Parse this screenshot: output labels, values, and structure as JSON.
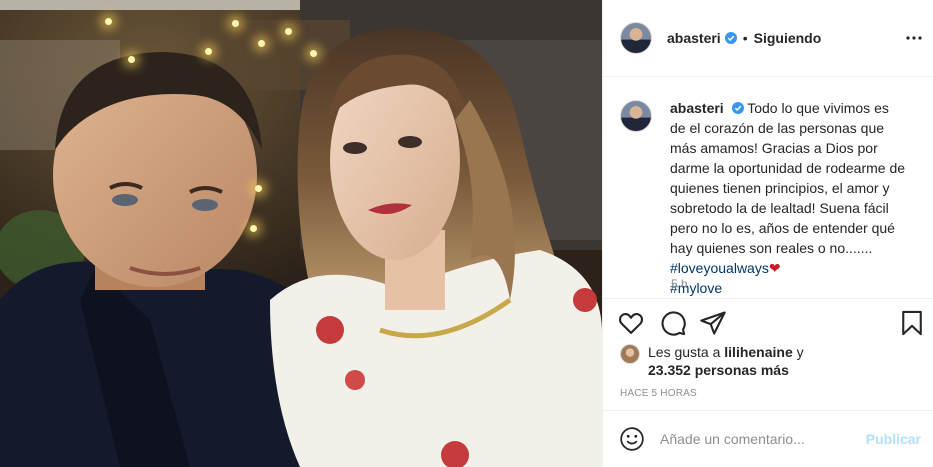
{
  "post": {
    "username": "abasteri",
    "verified": true,
    "follow_status": "Siguiendo",
    "separator": "•",
    "caption": {
      "username": "abasteri",
      "text": "Todo lo que vivimos es de el corazón de las personas que más amamos! Gracias a Dios por darme la oportunidad de rodearme de quienes tienen principios, el amor y sobretodo la de lealtad! Suena fácil pero no lo es, años de entender qué hay quienes son reales o no....... ",
      "hashtag1": "#loveyoualways",
      "heart": "❤",
      "hashtag2": "#mylove"
    },
    "time_short": "5 h",
    "likes": {
      "prefix": "Les gusta a ",
      "user": "lilihenaine",
      "conj": " y",
      "count_text": "23.352 personas más"
    },
    "time_ago": "HACE 5 HORAS"
  },
  "comment": {
    "placeholder": "Añade un comentario...",
    "publish_label": "Publicar"
  },
  "icons": {
    "more": "more-options-icon",
    "like": "heart-icon",
    "comment": "comment-icon",
    "share": "share-icon",
    "save": "bookmark-icon",
    "emoji": "emoji-icon",
    "verified": "verified-badge-icon"
  },
  "colors": {
    "link": "#00376b",
    "verified": "#3897f0",
    "publish_disabled": "#b2dffc",
    "muted": "#8e8e8e"
  }
}
